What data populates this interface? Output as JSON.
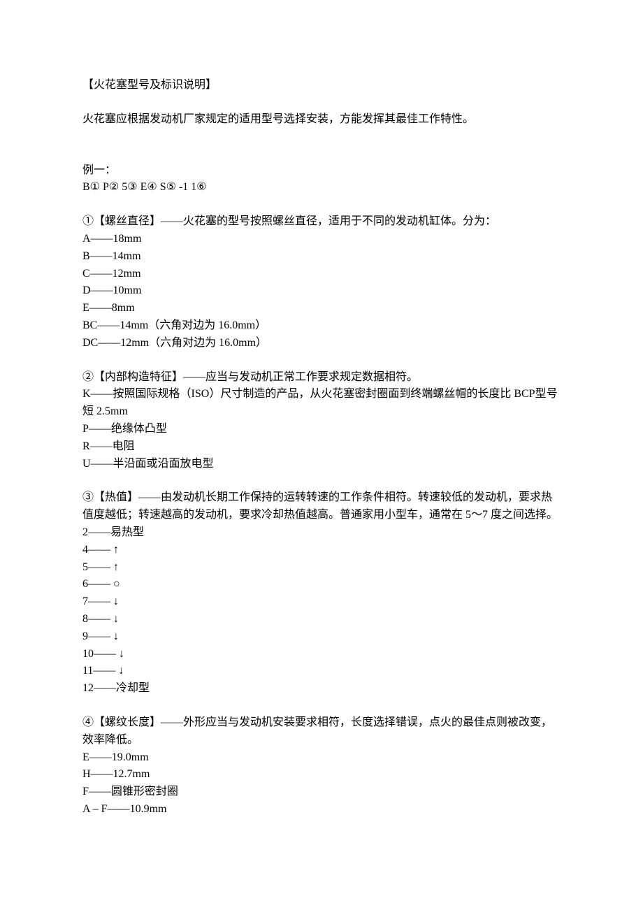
{
  "title": "【火花塞型号及标识说明】",
  "intro": "火花塞应根据发动机厂家规定的适用型号选择安装，方能发挥其最佳工作特性。",
  "example": {
    "label": "例一：",
    "code": "B① P② 5③ E④ S⑤ -1 1⑥"
  },
  "sections": [
    {
      "heading": "①【螺丝直径】——火花塞的型号按照螺丝直径，适用于不同的发动机缸体。分为：",
      "lines": [
        "A——18mm",
        "B——14mm",
        "C——12mm",
        "D——10mm",
        "E——8mm",
        "BC——14mm（六角对边为 16.0mm）",
        "DC——12mm（六角对边为 16.0mm）"
      ]
    },
    {
      "heading": "②【内部构造特征】——应当与发动机正常工作要求规定数据相符。",
      "lines": [
        "K——按照国际规格（ISO）尺寸制造的产品，从火花塞密封圈面到终端螺丝帽的长度比 BCP型号短 2.5mm",
        "P——绝缘体凸型",
        "R——电阻",
        "U——半沿面或沿面放电型"
      ]
    },
    {
      "heading": "③【热值】——由发动机长期工作保持的运转转速的工作条件相符。转速较低的发动机，要求热值度越低；转速越高的发动机，要求冷却热值越高。普通家用小型车，通常在 5～7 度之间选择。",
      "lines": [
        "2——易热型",
        "4—— ↑",
        "5—— ↑",
        "6—— ○",
        "7—— ↓",
        "8—— ↓",
        "9—— ↓",
        "10—— ↓",
        "11—— ↓",
        "12——冷却型"
      ]
    },
    {
      "heading": "④【螺纹长度】——外形应当与发动机安装要求相符，长度选择错误，点火的最佳点则被改变，效率降低。",
      "lines": [
        "E——19.0mm",
        "H——12.7mm",
        "F——圆锥形密封圈",
        "A – F——10.9mm"
      ]
    }
  ]
}
